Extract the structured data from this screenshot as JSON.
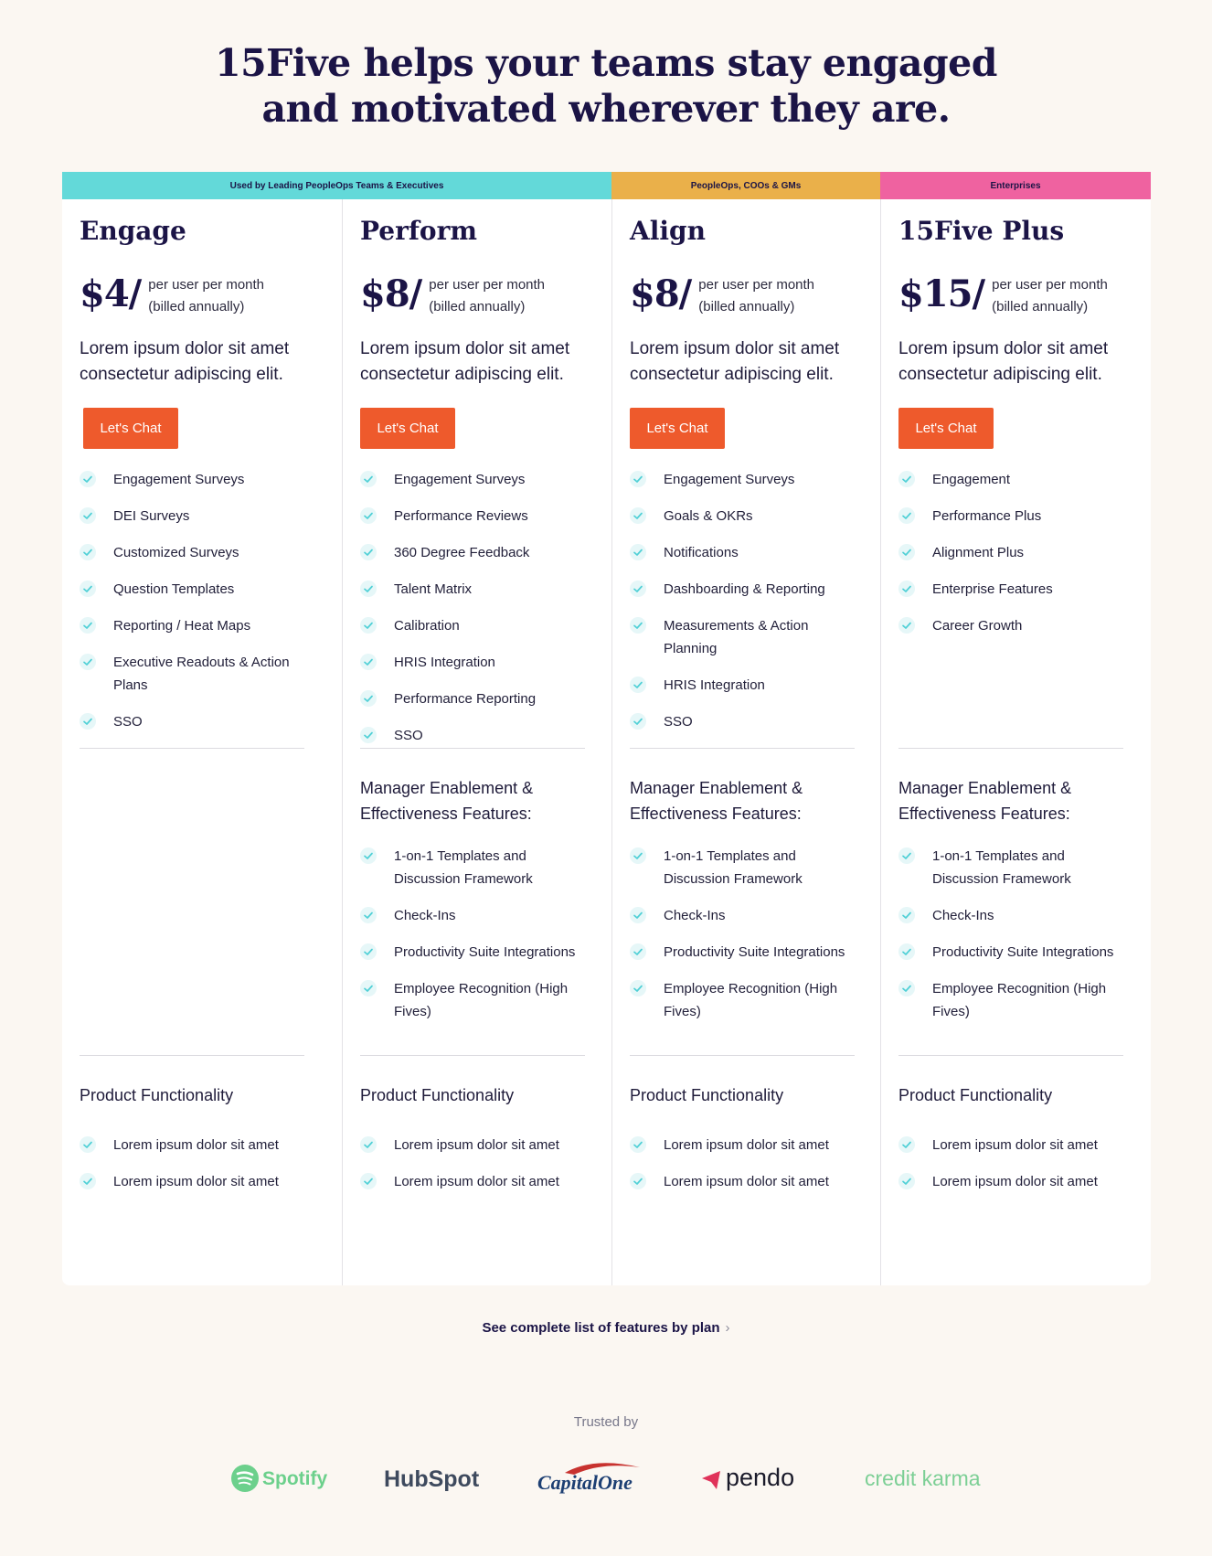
{
  "headline": {
    "line1": "15Five helps your teams stay engaged",
    "line2": "and motivated wherever they are."
  },
  "bands": [
    "Used by Leading PeopleOps Teams & Executives",
    "PeopleOps, COOs & GMs",
    "Enterprises"
  ],
  "plans": [
    {
      "name": "Engage",
      "price": "$4/",
      "price_note_1": "per user per month",
      "price_note_2": "(billed annually)",
      "desc_1": "Lorem ipsum dolor sit amet",
      "desc_2": "consectetur adipiscing elit.",
      "cta": "Let's Chat",
      "features": [
        "Engagement Surveys",
        "DEI Surveys",
        "Customized Surveys",
        "Question Templates",
        "Reporting / Heat Maps",
        "Executive Readouts & Action Plans",
        "SSO"
      ],
      "product_title": "Product Functionality",
      "product_features": [
        "Lorem ipsum dolor sit amet",
        "Lorem ipsum dolor sit amet"
      ]
    },
    {
      "name": "Perform",
      "price": "$8/",
      "price_note_1": "per user per month",
      "price_note_2": "(billed annually)",
      "desc_1": "Lorem ipsum dolor sit amet",
      "desc_2": "consectetur adipiscing elit.",
      "cta": "Let's Chat",
      "features": [
        "Engagement Surveys",
        "Performance Reviews",
        "360 Degree Feedback",
        "Talent Matrix",
        "Calibration",
        "HRIS Integration",
        "Performance Reporting",
        "SSO"
      ],
      "manager_title_1": "Manager Enablement &",
      "manager_title_2": "Effectiveness Features:",
      "manager_features": [
        "1-on-1 Templates and Discussion Framework",
        "Check-Ins",
        "Productivity Suite Integrations",
        "Employee Recognition (High Fives)"
      ],
      "product_title": "Product Functionality",
      "product_features": [
        "Lorem ipsum dolor sit amet",
        "Lorem ipsum dolor sit amet"
      ]
    },
    {
      "name": "Align",
      "price": "$8/",
      "price_note_1": "per user per month",
      "price_note_2": "(billed annually)",
      "desc_1": "Lorem ipsum dolor sit amet",
      "desc_2": "consectetur adipiscing elit.",
      "cta": "Let's Chat",
      "features": [
        "Engagement Surveys",
        "Goals & OKRs",
        "Notifications",
        "Dashboarding & Reporting",
        "Measurements & Action Planning",
        "HRIS Integration",
        "SSO"
      ],
      "manager_title_1": "Manager Enablement &",
      "manager_title_2": "Effectiveness Features:",
      "manager_features": [
        "1-on-1 Templates and Discussion Framework",
        "Check-Ins",
        "Productivity Suite Integrations",
        "Employee Recognition (High Fives)"
      ],
      "product_title": "Product Functionality",
      "product_features": [
        "Lorem ipsum dolor sit amet",
        "Lorem ipsum dolor sit amet"
      ]
    },
    {
      "name": "15Five Plus",
      "price": "$15/",
      "price_note_1": "per user per month",
      "price_note_2": "(billed annually)",
      "desc_1": "Lorem ipsum dolor sit amet",
      "desc_2": "consectetur adipiscing elit.",
      "cta": "Let's Chat",
      "features": [
        "Engagement",
        "Performance Plus",
        "Alignment Plus",
        "Enterprise Features",
        "Career Growth"
      ],
      "manager_title_1": "Manager Enablement &",
      "manager_title_2": "Effectiveness Features:",
      "manager_features": [
        "1-on-1 Templates and Discussion Framework",
        "Check-Ins",
        "Productivity Suite Integrations",
        "Employee Recognition (High Fives)"
      ],
      "product_title": "Product Functionality",
      "product_features": [
        "Lorem ipsum dolor sit amet",
        "Lorem ipsum dolor sit amet"
      ]
    }
  ],
  "see_all": "See complete list of features by plan",
  "trusted_by": "Trusted by",
  "logos": {
    "spotify": "Spotify",
    "hubspot": "HubSpot",
    "capitalone": "CapitalOne",
    "pendo": "pendo",
    "creditkarma": "credit karma"
  },
  "colors": {
    "band_teal": "#63d9d9",
    "band_orange": "#eab04a",
    "band_pink": "#ef62a0",
    "cta": "#ee5a2c",
    "check": "#4fd0d6",
    "navy": "#1b1446"
  }
}
